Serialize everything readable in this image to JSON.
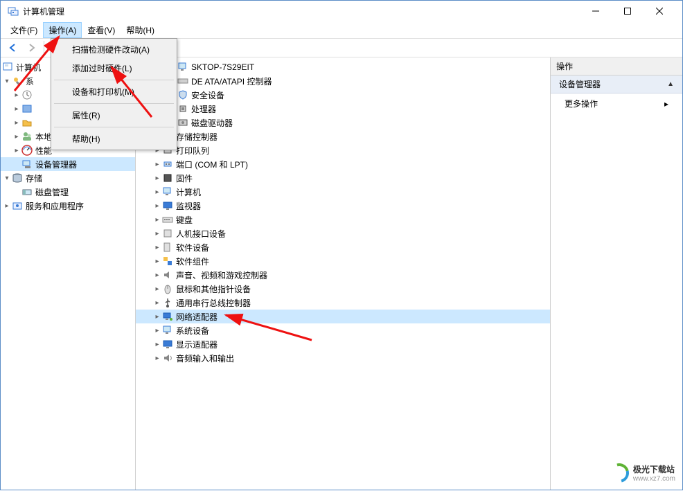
{
  "window": {
    "title": "计算机管理"
  },
  "menus": {
    "file": "文件(F)",
    "action": "操作(A)",
    "view": "查看(V)",
    "help": "帮助(H)"
  },
  "dropdown": {
    "scan": "扫描检测硬件改动(A)",
    "legacy": "添加过时硬件(L)",
    "devices": "设备和打印机(M)",
    "properties": "属性(R)",
    "help": "帮助(H)"
  },
  "left_tree": {
    "root_partial": "计算机",
    "system_tools_partial": "系",
    "local_users": "本地用户和组",
    "performance": "性能",
    "device_manager": "设备管理器",
    "storage": "存储",
    "disk_mgmt": "磁盘管理",
    "services": "服务和应用程序"
  },
  "center_tree": {
    "root_partial": "SKTOP-7S29EIT",
    "ide": "DE ATA/ATAPI 控制器",
    "security": "安全设备",
    "processor": "处理器",
    "disk_drives": "磁盘驱动器",
    "storage_ctrl": "存储控制器",
    "print_queue": "打印队列",
    "ports": "端口 (COM 和 LPT)",
    "firmware": "固件",
    "computer": "计算机",
    "monitor": "监视器",
    "keyboard": "键盘",
    "hid": "人机接口设备",
    "software_dev": "软件设备",
    "software_comp": "软件组件",
    "sound": "声音、视频和游戏控制器",
    "mouse": "鼠标和其他指针设备",
    "usb": "通用串行总线控制器",
    "network": "网络适配器",
    "system_dev": "系统设备",
    "display": "显示适配器",
    "audio_io": "音频输入和输出"
  },
  "right": {
    "header": "操作",
    "section": "设备管理器",
    "more": "更多操作"
  },
  "watermark": {
    "brand": "极光下载站",
    "url": "www.xz7.com"
  }
}
